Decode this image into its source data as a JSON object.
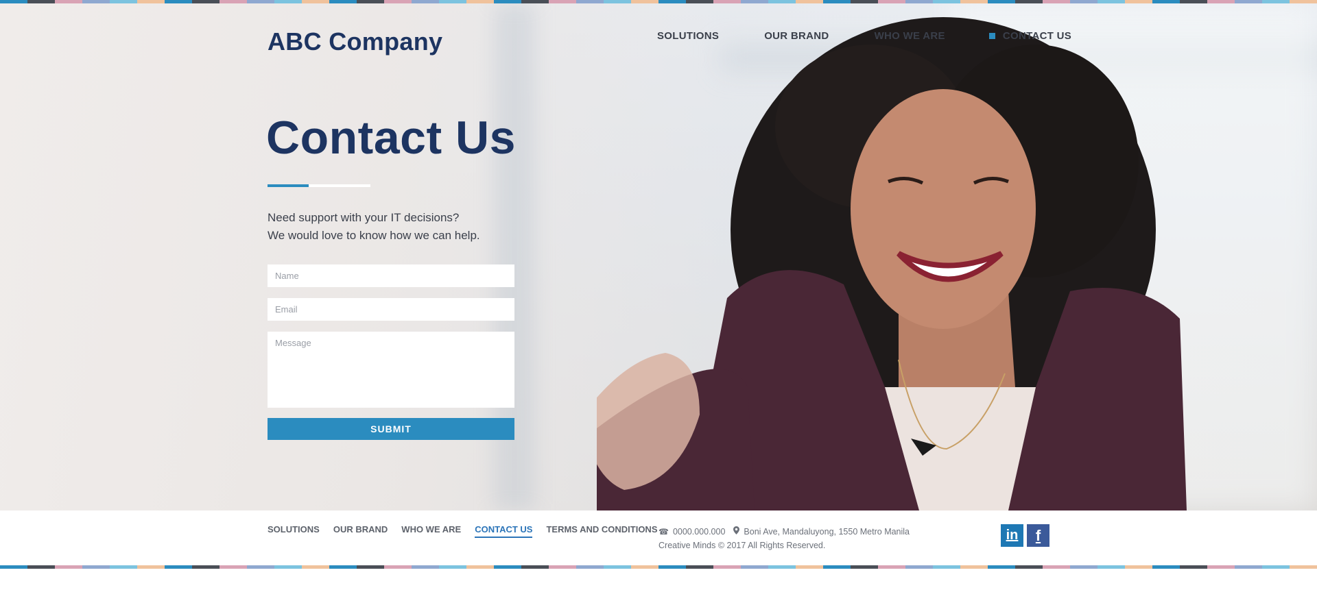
{
  "header": {
    "brand": "ABC Company",
    "nav": [
      {
        "label": "SOLUTIONS"
      },
      {
        "label": "OUR BRAND"
      },
      {
        "label": "WHO WE ARE"
      },
      {
        "label": "CONTACT US",
        "active": true
      }
    ]
  },
  "hero": {
    "title": "Contact Us",
    "intro_line1": "Need support with your IT decisions?",
    "intro_line2": "We would love to know how we can help."
  },
  "form": {
    "name_placeholder": "Name",
    "email_placeholder": "Email",
    "message_placeholder": "Message",
    "submit_label": "SUBMIT"
  },
  "footer": {
    "nav": [
      {
        "label": "SOLUTIONS"
      },
      {
        "label": "OUR BRAND"
      },
      {
        "label": "WHO WE ARE"
      },
      {
        "label": "CONTACT US",
        "active": true
      },
      {
        "label": "TERMS AND CONDITIONS"
      }
    ],
    "phone": "0000.000.000",
    "address": "Boni Ave, Mandaluyong, 1550 Metro Manila",
    "copyright": "Creative Minds © 2017 All Rights Reserved.",
    "social": [
      {
        "icon": "linkedin-icon",
        "glyph": "in"
      },
      {
        "icon": "facebook-icon",
        "glyph": "f"
      }
    ]
  },
  "colors": {
    "brand_navy": "#1d3461",
    "accent_blue": "#2b8cbf",
    "stripe": [
      "#2b8cbf",
      "#4a4f57",
      "#d9a3b5",
      "#8fa8d0",
      "#7cc3df",
      "#f0c29c",
      "#2b8cbf",
      "#4a4f57",
      "#d9a3b5",
      "#8fa8d0",
      "#7cc3df",
      "#f0c29c"
    ]
  }
}
